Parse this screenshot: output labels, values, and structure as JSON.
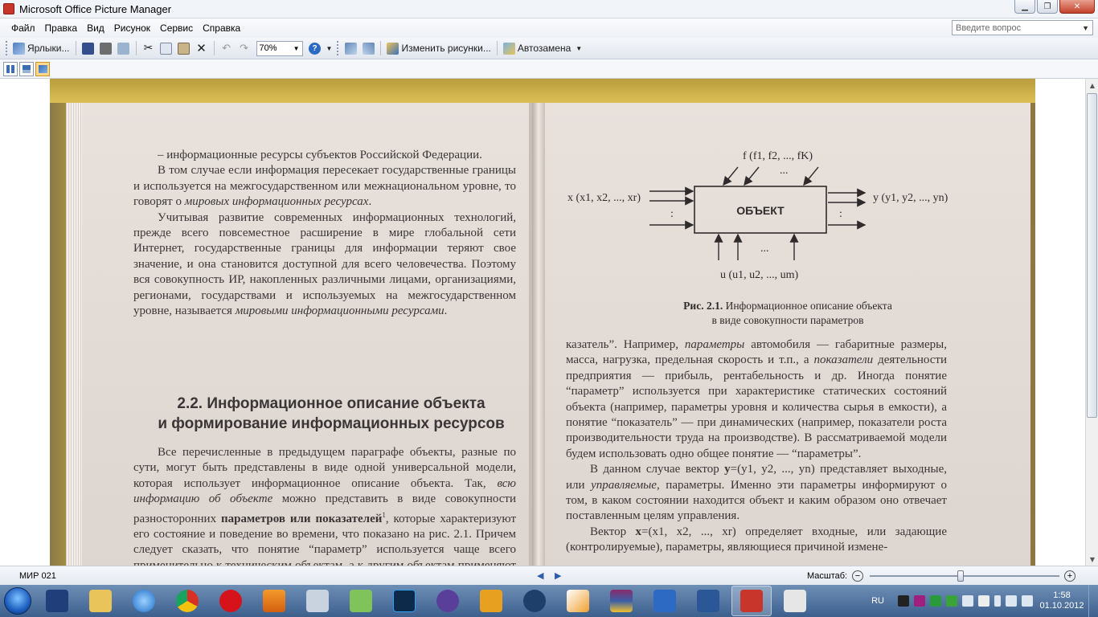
{
  "window": {
    "title": "Microsoft Office Picture Manager"
  },
  "menu": {
    "items": [
      "Файл",
      "Правка",
      "Вид",
      "Рисунок",
      "Сервис",
      "Справка"
    ],
    "help_placeholder": "Введите вопрос"
  },
  "toolbar": {
    "shortcuts_label": "Ярлыки...",
    "zoom_value": "70%",
    "edit_pictures_label": "Изменить рисунки...",
    "autocorrect_label": "Автозамена"
  },
  "book": {
    "left_para1": "– информационные ресурсы субъектов Российской Федерации.",
    "left_para2_a": "В том случае если информация пересекает государственные границы и используется на межгосударственном или межнациональном уровне, то говорят о ",
    "left_para2_it": "мировых информационных ресурсах",
    "left_para2_b": ".",
    "left_para3_a": "Учитывая развитие современных информационных технологий, прежде всего повсеместное расширение в мире глобальной сети Интернет, государственные границы для информации теряют свое значение, и она становится доступной для всего человечества. Поэтому вся совокупность ИР, накопленных различными лицами, организациями, регионами, государствами и используемых на межгосударственном уровне, называется ",
    "left_para3_it": "мировыми информационными ресурсами",
    "left_para3_b": ".",
    "heading_line1": "2.2. Информационное описание объекта",
    "heading_line2": "и формирование информационных ресурсов",
    "left_para4_a": "Все перечисленные в предыдущем параграфе объекты, разные по сути, могут быть представлены в виде одной универсальной модели, которая использует информационное описание объекта. Так, ",
    "left_para4_it": "всю информацию об объекте",
    "left_para4_b": " можно представить в виде совокупности разносторонних ",
    "left_para4_bold": "параметров или показателей",
    "left_para4_sup": "1",
    "left_para4_c": ", которые характеризуют его состояние и поведение во времени, что показано на рис. 2.1. Причем следует сказать, что понятие “параметр” используется чаще всего применительно к техническим объектам, а к другим объектам применяют понятие “по-",
    "fig_top_label": "f (f1, f2, ..., fK)",
    "fig_left_label": "x (x1, x2, ..., xr)",
    "fig_right_label": "y (y1, y2, ..., yn)",
    "fig_bottom_label": "u (u1, u2, ..., um)",
    "fig_box_label": "ОБЪЕКТ",
    "fig_dots": "...",
    "fig_colon": ":",
    "caption_bold": "Рис. 2.1.",
    "caption_line1": " Информационное описание объекта",
    "caption_line2": "в виде совокупности параметров",
    "right_para1_a": "казатель”. Например, ",
    "right_para1_it": "параметры",
    "right_para1_b": " автомобиля — габаритные размеры, масса, нагрузка, предельная скорость и т.п., а ",
    "right_para1_it2": "показатели",
    "right_para1_c": " деятельности предприятия — прибыль, рентабельность и др. Иногда понятие “параметр” используется при характеристике статических состояний объекта (например, параметры уровня и количества сырья в емкости), а понятие “показатель” — при динамических (например, показатели роста производительности труда на производстве). В рассматриваемой модели будем использовать одно общее понятие — “параметры”.",
    "right_para2_a": "В данном случае вектор ",
    "right_para2_b": "y",
    "right_para2_c": "=(y1, y2, ..., yn) представляет выходные, или ",
    "right_para2_it": "управляемые",
    "right_para2_d": ", параметры. Именно эти параметры информируют о том, в каком состоянии находится объект и каким образом оно отвечает поставленным целям управления.",
    "right_para3_a": "Вектор ",
    "right_para3_b": "x",
    "right_para3_c": "=(x1, x2, ..., xr) определяет входные, или задающие (контролируемые), параметры, являющиеся причиной измене-"
  },
  "status": {
    "file_name": "МИР 021",
    "zoom_label": "Масштаб:",
    "zoom_slider_fraction": 0.48
  },
  "taskbar": {
    "lang": "RU",
    "time": "1:58",
    "date": "01.10.2012"
  }
}
